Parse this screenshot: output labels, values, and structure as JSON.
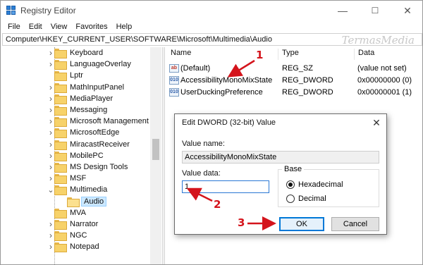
{
  "window": {
    "title": "Registry Editor"
  },
  "titlebar_buttons": {
    "minimize": "—",
    "maximize": "☐",
    "close": "✕"
  },
  "menu": [
    "File",
    "Edit",
    "View",
    "Favorites",
    "Help"
  ],
  "address": "Computer\\HKEY_CURRENT_USER\\SOFTWARE\\Microsoft\\Multimedia\\Audio",
  "watermark": "TermasMedia",
  "tree": [
    {
      "label": "Keyboard",
      "expandable": true
    },
    {
      "label": "LanguageOverlay",
      "expandable": true
    },
    {
      "label": "Lptr",
      "expandable": false
    },
    {
      "label": "MathInputPanel",
      "expandable": true
    },
    {
      "label": "MediaPlayer",
      "expandable": true
    },
    {
      "label": "Messaging",
      "expandable": true
    },
    {
      "label": "Microsoft Management",
      "expandable": true
    },
    {
      "label": "MicrosoftEdge",
      "expandable": true
    },
    {
      "label": "MiracastReceiver",
      "expandable": true
    },
    {
      "label": "MobilePC",
      "expandable": true
    },
    {
      "label": "MS Design Tools",
      "expandable": true
    },
    {
      "label": "MSF",
      "expandable": true
    },
    {
      "label": "Multimedia",
      "expandable": true,
      "expanded": true
    },
    {
      "label": "Audio",
      "expandable": false,
      "selected": true,
      "child": true
    },
    {
      "label": "MVA",
      "expandable": false
    },
    {
      "label": "Narrator",
      "expandable": true
    },
    {
      "label": "NGC",
      "expandable": true
    },
    {
      "label": "Notepad",
      "expandable": true
    }
  ],
  "columns": {
    "name": "Name",
    "type": "Type",
    "data": "Data"
  },
  "values": [
    {
      "icon": "ab",
      "name": "(Default)",
      "type": "REG_SZ",
      "data": "(value not set)"
    },
    {
      "icon": "010",
      "name": "AccessibilityMonoMixState",
      "type": "REG_DWORD",
      "data": "0x00000000 (0)"
    },
    {
      "icon": "010",
      "name": "UserDuckingPreference",
      "type": "REG_DWORD",
      "data": "0x00000001 (1)"
    }
  ],
  "dialog": {
    "title": "Edit DWORD (32-bit) Value",
    "close": "✕",
    "value_name_label": "Value name:",
    "value_name": "AccessibilityMonoMixState",
    "value_data_label": "Value data:",
    "value_data": "1",
    "base_label": "Base",
    "hex_label": "Hexadecimal",
    "dec_label": "Decimal",
    "selected_base": "Hexadecimal",
    "ok": "OK",
    "cancel": "Cancel"
  },
  "annotations": {
    "one": "1",
    "two": "2",
    "three": "3"
  },
  "colors": {
    "accent": "#0078d7",
    "annotation": "#d4141c",
    "selection": "#cce8ff"
  }
}
